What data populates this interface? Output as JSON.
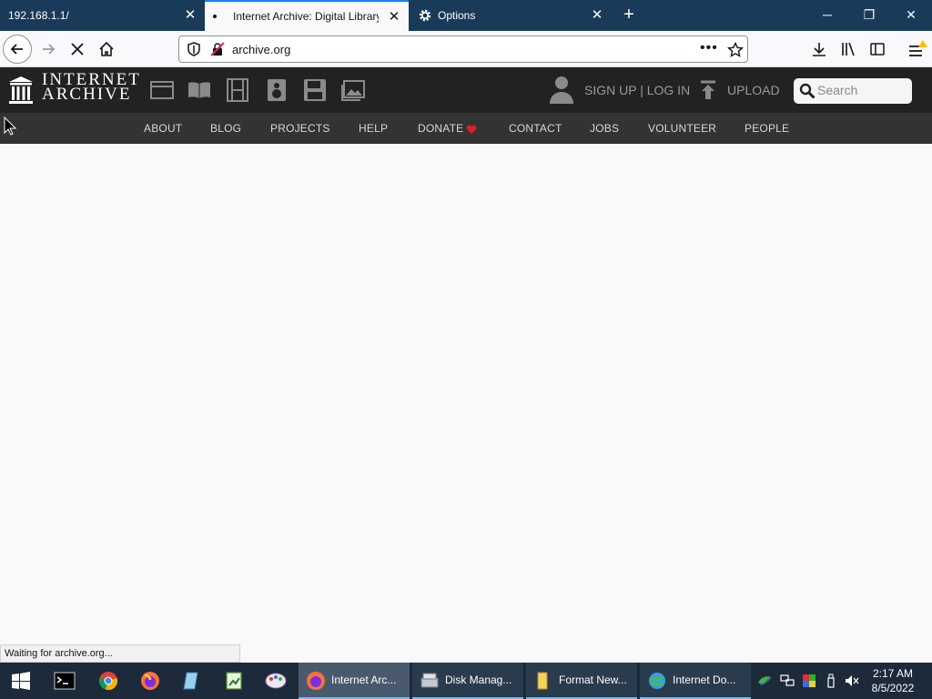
{
  "browser": {
    "tabs": [
      {
        "title": "192.168.1.1/"
      },
      {
        "title": "Internet Archive: Digital Library"
      },
      {
        "title": "Options"
      }
    ],
    "url": "archive.org",
    "status": "Waiting for archive.org..."
  },
  "site": {
    "logo_line1": "INTERNET",
    "logo_line2": "ARCHIVE",
    "media_icons": [
      "web-icon",
      "book-icon",
      "film-icon",
      "audio-icon",
      "software-icon",
      "images-icon"
    ],
    "signup_login": "SIGN UP | LOG IN",
    "upload": "UPLOAD",
    "search_placeholder": "Search",
    "nav": [
      "ABOUT",
      "BLOG",
      "PROJECTS",
      "HELP",
      "DONATE",
      "CONTACT",
      "JOBS",
      "VOLUNTEER",
      "PEOPLE"
    ],
    "donate_heart_color": "#e02020"
  },
  "taskbar": {
    "apps": [
      {
        "label": "Internet Arc...",
        "active": true
      },
      {
        "label": "Disk Manag...",
        "active": false
      },
      {
        "label": "Format New...",
        "active": false
      },
      {
        "label": "Internet Do...",
        "active": false
      }
    ],
    "time": "2:17 AM",
    "date": "8/5/2022"
  },
  "colors": {
    "tabstrip": "#1a3a5a",
    "site_header": "#222222",
    "site_subnav": "#333333",
    "taskbar": "#1c2a3a"
  }
}
